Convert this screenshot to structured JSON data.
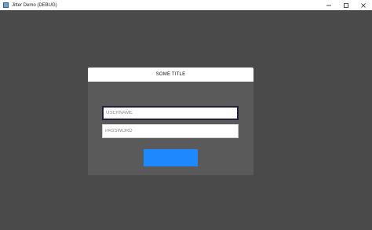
{
  "window": {
    "title": "Jitter Demo (DEBUG)",
    "icon": "app-icon",
    "controls": {
      "minimize": "minimize-icon",
      "maximize": "maximize-icon",
      "close": "close-icon"
    }
  },
  "dialog": {
    "title": "SOME TITLE",
    "username": {
      "placeholder": "USERNAME",
      "value": ""
    },
    "password": {
      "placeholder": "PASSWORD",
      "value": ""
    },
    "submit_label": ""
  },
  "colors": {
    "background": "#4a4a4a",
    "dialog_body": "#5a5a5a",
    "accent": "#1e88ff"
  }
}
